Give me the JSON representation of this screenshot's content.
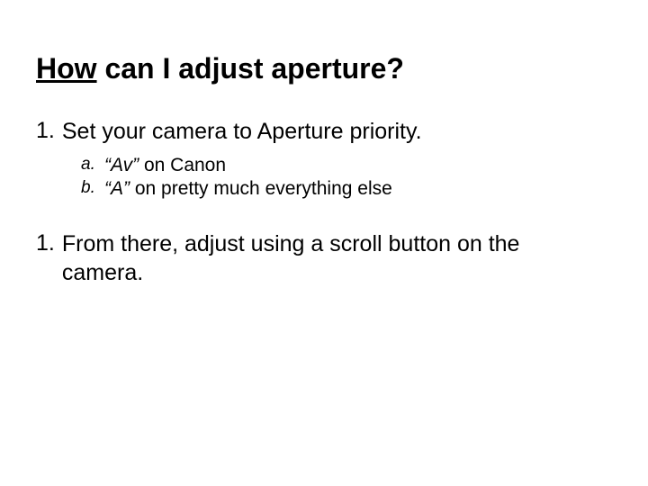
{
  "title": {
    "underlined": "How",
    "rest": " can I adjust aperture?"
  },
  "items": [
    {
      "number": "1.",
      "text": "Set your camera to Aperture priority.",
      "subitems": [
        {
          "marker": "a.",
          "italic": "“Av”",
          "rest": " on Canon"
        },
        {
          "marker": "b.",
          "italic": "“A”",
          "rest": " on pretty much everything else"
        }
      ]
    },
    {
      "number": "1.",
      "text": "From there, adjust using a scroll button on the camera."
    }
  ]
}
